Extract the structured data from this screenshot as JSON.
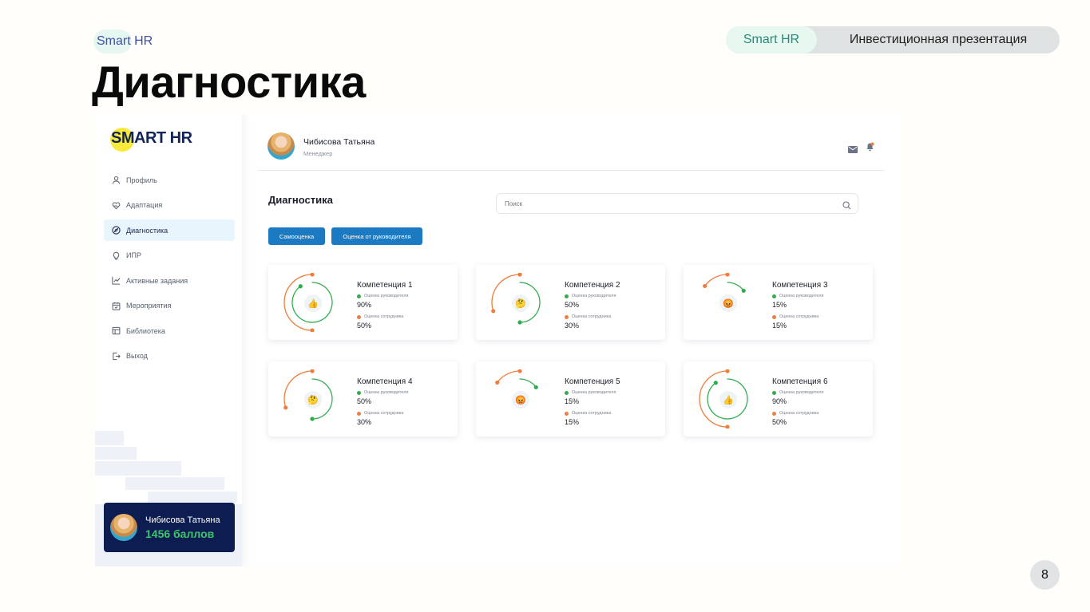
{
  "slide": {
    "brand": "Smart HR",
    "title": "Диагностика",
    "pill_left": "Smart HR",
    "pill_right": "Инвестиционная презентация",
    "page_number": "8"
  },
  "app": {
    "logo_part1": "SM",
    "logo_part2": "ART HR",
    "menu": [
      {
        "label": "Профиль",
        "icon": "user-icon"
      },
      {
        "label": "Адаптация",
        "icon": "heart-hand-icon"
      },
      {
        "label": "Диагностика",
        "icon": "compass-icon",
        "active": true
      },
      {
        "label": "ИПР",
        "icon": "lightbulb-icon"
      },
      {
        "label": "Активные задания",
        "icon": "chart-line-icon"
      },
      {
        "label": "Мероприятия",
        "icon": "calendar-icon"
      },
      {
        "label": "Библиотека",
        "icon": "table-icon"
      },
      {
        "label": "Выход",
        "icon": "logout-icon"
      }
    ],
    "user_card": {
      "name": "Чибисова Татьяна",
      "points": "1456 баллов"
    },
    "header": {
      "name": "Чибисова Татьяна",
      "role": "Менеджер"
    },
    "page_title": "Диагностика",
    "search_placeholder": "Поиск",
    "buttons": {
      "self": "Самооценка",
      "manager": "Оценка от руководителя"
    },
    "labels": {
      "manager": "Оценка руководителя",
      "employee": "Оценка сотрудника"
    },
    "colors": {
      "manager": "#2fae4e",
      "employee": "#f07d3c",
      "accent": "#1b7ac1",
      "sidebar_card": "#0d1d52"
    },
    "competencies": [
      {
        "title": "Компетенция 1",
        "manager": "90%",
        "employee": "50%",
        "manager_value": 0.9,
        "employee_value": 0.5,
        "emoji": "👍",
        "icon": "thumbs-up-icon"
      },
      {
        "title": "Компетенция 2",
        "manager": "50%",
        "employee": "30%",
        "manager_value": 0.5,
        "employee_value": 0.3,
        "emoji": "🤔",
        "icon": "thinking-face-icon"
      },
      {
        "title": "Компетенция 3",
        "manager": "15%",
        "employee": "15%",
        "manager_value": 0.15,
        "employee_value": 0.15,
        "emoji": "😡",
        "icon": "angry-face-icon"
      },
      {
        "title": "Компетенция 4",
        "manager": "50%",
        "employee": "30%",
        "manager_value": 0.5,
        "employee_value": 0.3,
        "emoji": "🤔",
        "icon": "thinking-face-icon"
      },
      {
        "title": "Компетенция 5",
        "manager": "15%",
        "employee": "15%",
        "manager_value": 0.15,
        "employee_value": 0.15,
        "emoji": "😡",
        "icon": "angry-face-icon"
      },
      {
        "title": "Компетенция 6",
        "manager": "90%",
        "employee": "50%",
        "manager_value": 0.9,
        "employee_value": 0.5,
        "emoji": "👍",
        "icon": "thumbs-up-icon"
      }
    ]
  }
}
